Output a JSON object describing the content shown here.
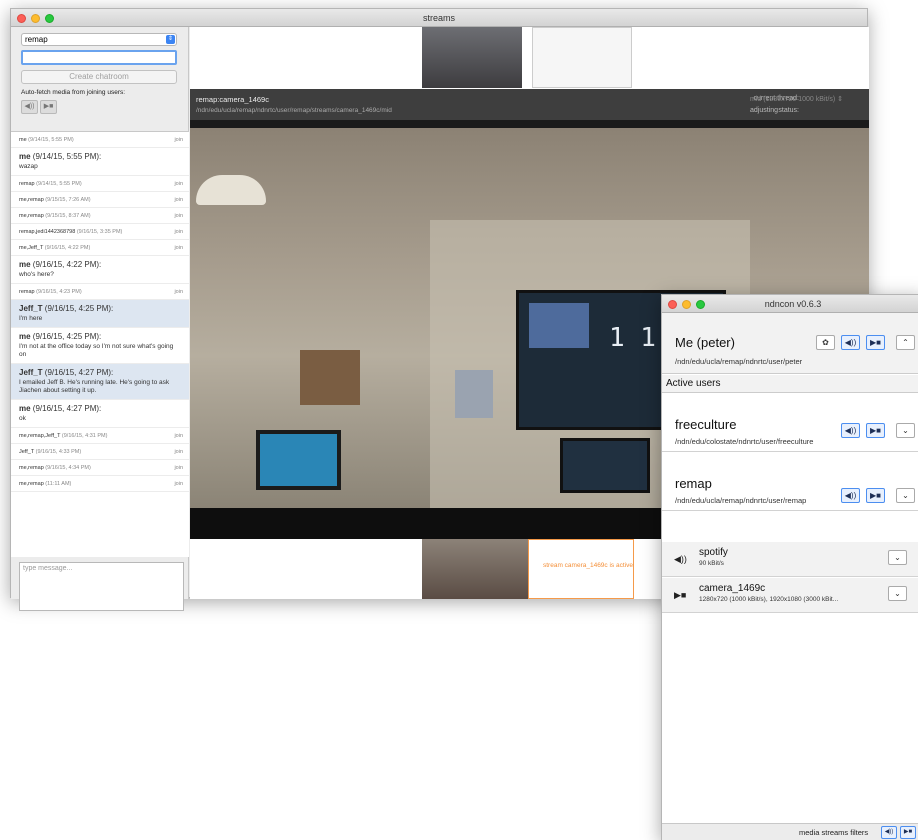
{
  "main_window": {
    "title": "streams",
    "chatroom_select": "remap",
    "room_input_value": "",
    "create_chatroom_label": "Create chatroom",
    "autofetch_label": "Auto-fetch media from joining users:",
    "autofetch_audio": "◀))",
    "autofetch_video": "▶■",
    "chat": [
      {
        "type": "sys",
        "who": "me",
        "time": "(9/14/15, 5:55 PM)",
        "action": "join"
      },
      {
        "type": "msg",
        "who": "me",
        "time": "(9/14/15, 5:55 PM):",
        "body": "wazap",
        "hl": false
      },
      {
        "type": "sys",
        "who": "remap",
        "time": "(9/14/15, 5:55 PM)",
        "action": "join"
      },
      {
        "type": "sys",
        "who": "me,remap",
        "time": "(9/15/15, 7:26 AM)",
        "action": "join"
      },
      {
        "type": "sys",
        "who": "me,remap",
        "time": "(9/15/15, 8:37 AM)",
        "action": "join"
      },
      {
        "type": "sys",
        "who": "remap,jedi1442368798",
        "time": "(9/16/15, 3:35 PM)",
        "action": "join"
      },
      {
        "type": "sys",
        "who": "me,Jeff_T",
        "time": "(9/16/15, 4:22 PM)",
        "action": "join"
      },
      {
        "type": "msg",
        "who": "me",
        "time": "(9/16/15, 4:22 PM):",
        "body": "who's here?",
        "hl": false
      },
      {
        "type": "sys",
        "who": "remap",
        "time": "(9/16/15, 4:23 PM)",
        "action": "join"
      },
      {
        "type": "msg",
        "who": "Jeff_T",
        "time": "(9/16/15, 4:25 PM):",
        "body": "I'm here",
        "hl": true
      },
      {
        "type": "msg",
        "who": "me",
        "time": "(9/16/15, 4:25 PM):",
        "body": "I'm not at the office today so I'm not sure what's going on",
        "hl": false
      },
      {
        "type": "msg",
        "who": "Jeff_T",
        "time": "(9/16/15, 4:27 PM):",
        "body": "I emailed Jeff B. He's running late. He's going to ask Jiachen about setting it up.",
        "hl": true
      },
      {
        "type": "msg",
        "who": "me",
        "time": "(9/16/15, 4:27 PM):",
        "body": "ok",
        "hl": false
      },
      {
        "type": "sys",
        "who": "me,remap,Jeff_T",
        "time": "(9/16/15, 4:31 PM)",
        "action": "join"
      },
      {
        "type": "sys",
        "who": "Jeff_T",
        "time": "(9/16/15, 4:33 PM)",
        "action": "join"
      },
      {
        "type": "sys",
        "who": "me,remap",
        "time": "(9/16/15, 4:34 PM)",
        "action": "join"
      },
      {
        "type": "sys",
        "who": "me,remap",
        "time": "(11:11 AM)",
        "action": "join"
      }
    ],
    "message_placeholder": "type message...",
    "stream": {
      "name": "remap:camera_1469c",
      "path": "/ndn/edu/ucla/remap/ndnrtc/user/remap/streams/camera_1469c/mid",
      "thread_label": "current thread:",
      "thread_value": "mid (1280x720 1000 kBit/s)",
      "status_label": "status:",
      "status_value": "adjusting"
    },
    "active_stream_notice": "stream camera_1469c is active"
  },
  "ndncon": {
    "title": "ndncon v0.6.3",
    "me_name": "Me (peter)",
    "me_path": "/ndn/edu/ucla/remap/ndnrtc/user/peter",
    "active_users_header": "Active users",
    "users": [
      {
        "name": "freeculture",
        "path": "/ndn/edu/colostate/ndnrtc/user/freeculture"
      },
      {
        "name": "remap",
        "path": "/ndn/edu/ucla/remap/ndnrtc/user/remap"
      }
    ],
    "media": [
      {
        "icon": "◀))",
        "name": "spotify",
        "sub": "90 kBit/s"
      },
      {
        "icon": "▶■",
        "name": "camera_1469c",
        "sub": "1280x720 (1000 kBit/s), 1920x1080 (3000 kBit..."
      }
    ],
    "footer_label": "media streams filters",
    "icons": {
      "gear": "✿",
      "audio": "◀))",
      "video": "▶■",
      "expand": "⌃",
      "collapse": "⌄"
    }
  }
}
